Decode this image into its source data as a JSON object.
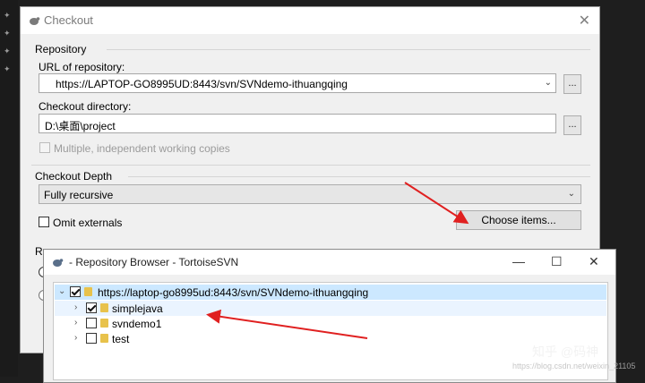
{
  "checkout": {
    "title": "Checkout",
    "repository_section": "Repository",
    "url_label": "URL of repository:",
    "url_value": "https://LAPTOP-GO8995UD:8443/svn/SVNdemo-ithuangqing",
    "url_browse": "...",
    "dir_label": "Checkout directory:",
    "dir_value": "D:\\桌面\\project",
    "dir_browse": "...",
    "multiple_label": "Multiple, independent working copies",
    "depth_section": "Checkout Depth",
    "depth_value": "Fully recursive",
    "omit_label": "Omit externals",
    "choose_button": "Choose items...",
    "revision_partial": "Re"
  },
  "repo_browser": {
    "title": "- Repository Browser - TortoiseSVN",
    "tree": [
      {
        "label": "https://laptop-go8995ud:8443/svn/SVNdemo-ithuangqing",
        "checked": true,
        "expanded": true
      },
      {
        "label": "simplejava",
        "checked": true,
        "expanded": false
      },
      {
        "label": "svndemo1",
        "checked": false,
        "expanded": false
      },
      {
        "label": "test",
        "checked": false,
        "expanded": false
      }
    ]
  },
  "watermark": {
    "text": "知乎 @码神",
    "sub_text": "https://blog.csdn.net/weixin_21105"
  },
  "colors": {
    "annotation_arrow": "#e02020",
    "selected_row": "#cce8ff",
    "folder": "#e8c24b"
  }
}
